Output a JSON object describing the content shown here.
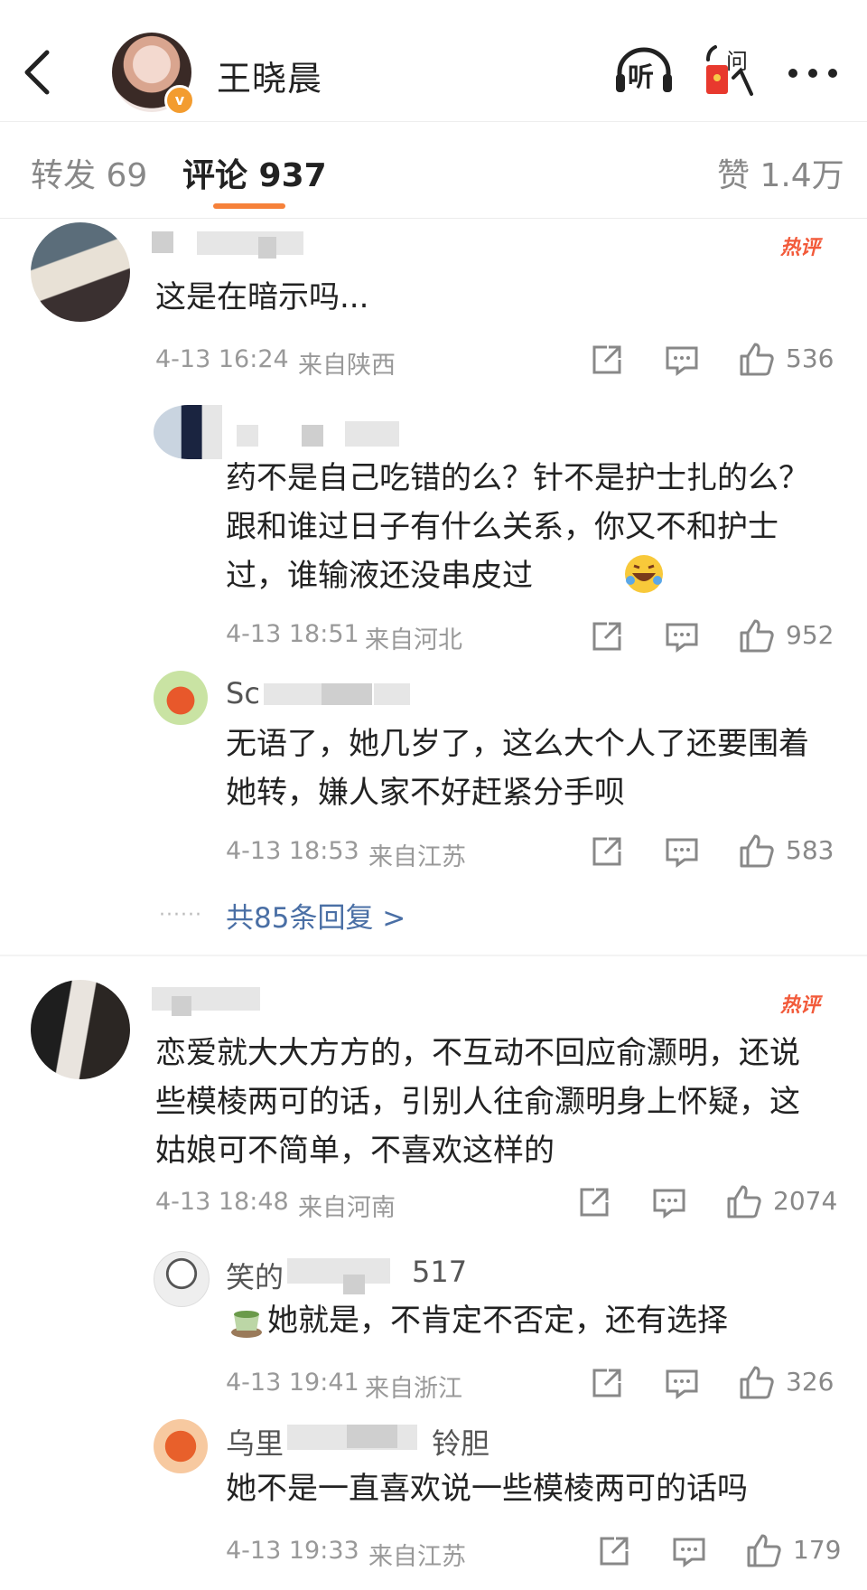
{
  "header": {
    "title": "王晓晨",
    "listen_label": "听",
    "ask_label": "问"
  },
  "tabs": [
    {
      "label": "转发 69"
    },
    {
      "label": "评论 937"
    },
    {
      "label": "赞 1.4万"
    }
  ],
  "comments": [
    {
      "hot_label": "热评",
      "text": "这是在暗示吗...",
      "time": "4-13 16:24",
      "location": "来自陕西",
      "likes": "536",
      "replies": [
        {
          "name": "",
          "text": "药不是自己吃错的么？针不是护士扎的么？跟和谁过日子有什么关系，你又不和护士过，谁输液还没串皮过",
          "time": "4-13 18:51",
          "location": "来自河北",
          "likes": "952"
        },
        {
          "name": "Sc",
          "text": "无语了，她几岁了，这么大个人了还要围着她转，嫌人家不好赶紧分手呗",
          "time": "4-13 18:53",
          "location": "来自江苏",
          "likes": "583"
        }
      ],
      "more_replies": "共85条回复 >"
    },
    {
      "hot_label": "热评",
      "text": "恋爱就大大方方的，不互动不回应俞灏明，还说些模棱两可的话，引别人往俞灏明身上怀疑，这姑娘可不简单，不喜欢这样的",
      "time": "4-13 18:48",
      "location": "来自河南",
      "likes": "2074",
      "replies": [
        {
          "name_start": "笑的",
          "name_end": "517",
          "text": "她就是，不肯定不否定，还有选择",
          "time": "4-13 19:41",
          "location": "来自浙江",
          "likes": "326"
        },
        {
          "name_start": "乌里",
          "name_end": "铃胆",
          "text": "她不是一直喜欢说一些模棱两可的话吗",
          "time": "4-13 19:33",
          "location": "来自江苏",
          "likes": "179"
        }
      ]
    }
  ],
  "colors": {
    "accent": "#f6813a",
    "link": "#4a6fa5",
    "hot": "#f25a3a",
    "vbadge": "#f39c2f"
  }
}
